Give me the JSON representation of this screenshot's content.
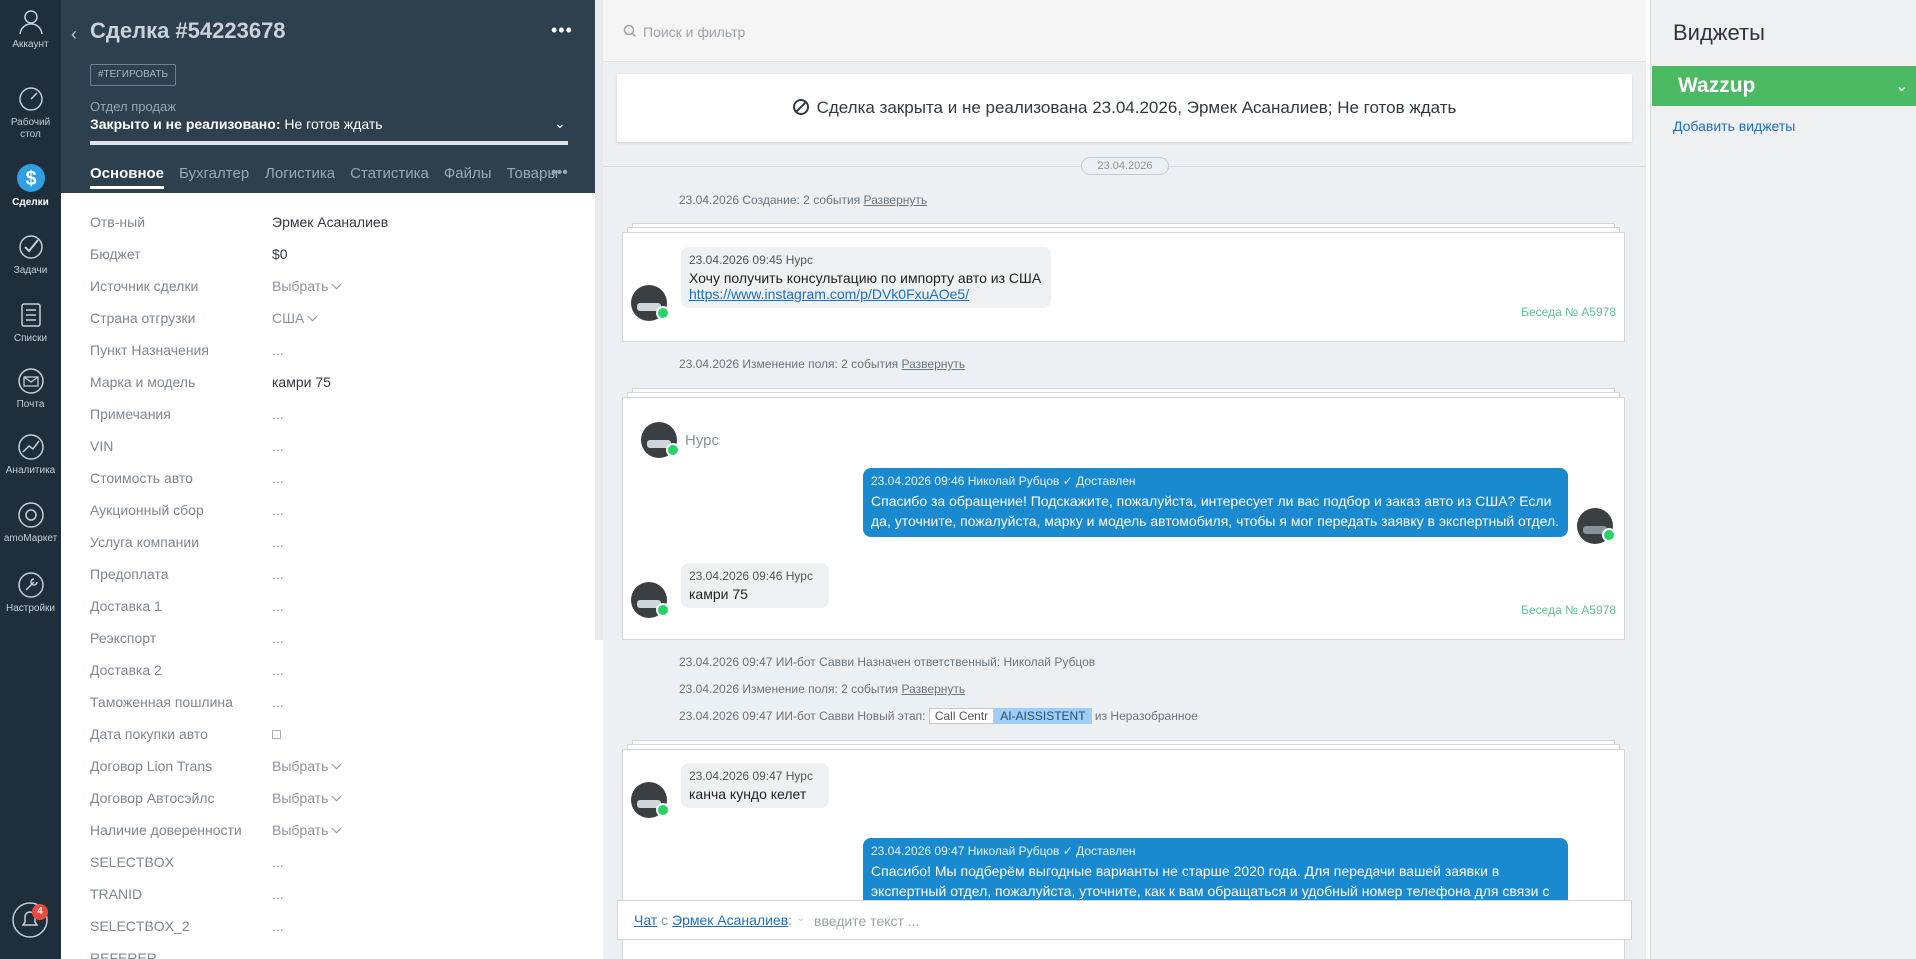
{
  "nav": {
    "account": "Аккаунт",
    "desktop": "Рабочий стол",
    "deals": "Сделки",
    "tasks": "Задачи",
    "lists": "Списки",
    "mail": "Почта",
    "analytics": "Аналитика",
    "market": "amoМаркет",
    "settings": "Настройки",
    "notifications_count": "4"
  },
  "card": {
    "title": "Сделка #54223678",
    "tag_button": "#ТЕГИРОВАТЬ",
    "pipeline": "Отдел продаж",
    "status_bold": "Закрыто и не реализовано:",
    "status_reason": " Не готов ждать",
    "tabs": [
      "Основное",
      "Бухгалтерия",
      "Логистика",
      "Статистика",
      "Файлы",
      "Товары"
    ],
    "fields": [
      {
        "label": "Отв-ный",
        "value": "Эрмек Асаналиев",
        "kind": "text"
      },
      {
        "label": "Бюджет",
        "value": "$0",
        "kind": "budget"
      },
      {
        "label": "Источник сделки",
        "value": "Выбрать",
        "kind": "select"
      },
      {
        "label": "Страна отгрузки",
        "value": "США",
        "kind": "select"
      },
      {
        "label": "Пункт Назначения",
        "value": "...",
        "kind": "dots"
      },
      {
        "label": "Марка и модель",
        "value": "камри 75",
        "kind": "text"
      },
      {
        "label": "Примечания",
        "value": "...",
        "kind": "dots"
      },
      {
        "label": "VIN",
        "value": "...",
        "kind": "dots"
      },
      {
        "label": "Стоимость авто",
        "value": "...",
        "kind": "dots"
      },
      {
        "label": "Аукционный сбор",
        "value": "...",
        "kind": "dots"
      },
      {
        "label": "Услуга компании",
        "value": "...",
        "kind": "dots"
      },
      {
        "label": "Предоплата",
        "value": "...",
        "kind": "dots"
      },
      {
        "label": "Доставка 1",
        "value": "...",
        "kind": "dots"
      },
      {
        "label": "Реэкспорт",
        "value": "...",
        "kind": "dots"
      },
      {
        "label": "Доставка 2",
        "value": "...",
        "kind": "dots"
      },
      {
        "label": "Таможенная пошлина",
        "value": "...",
        "kind": "dots"
      },
      {
        "label": "Дата покупки авто",
        "value": "",
        "kind": "date"
      },
      {
        "label": "Договор Lion Trans",
        "value": "Выбрать",
        "kind": "select"
      },
      {
        "label": "Договор Автосэйлс",
        "value": "Выбрать",
        "kind": "select"
      },
      {
        "label": "Наличие доверенности",
        "value": "Выбрать",
        "kind": "select"
      },
      {
        "label": "SELECTBOX",
        "value": "...",
        "kind": "dots"
      },
      {
        "label": "TRANID",
        "value": "...",
        "kind": "dots"
      },
      {
        "label": "SELECTBOX_2",
        "value": "...",
        "kind": "dots"
      },
      {
        "label": "REFERER",
        "value": "",
        "kind": "dots"
      }
    ]
  },
  "feed": {
    "search_placeholder": "Поиск и фильтр",
    "closed_banner": "Сделка закрыта и не реализована 23.04.2026, Эрмек Асаналиев; Не готов ждать",
    "date_pill": "23.04.2026",
    "sys1_text": "23.04.2026 Создание: 2 события ",
    "sys1_link": "Развернуть",
    "conv1": {
      "msg_meta": "23.04.2026 09:45 Нурс",
      "msg_text": "Хочу получить консультацию по импорту авто из США",
      "msg_link": "https://www.instagram.com/p/DVk0FxuAOe5/",
      "conv_id": "Беседа № A5978"
    },
    "sys2_text": "23.04.2026 Изменение поля: 2 события ",
    "sys2_link": "Развернуть",
    "conv2": {
      "name": "Нурс",
      "out_meta": "23.04.2026 09:46 Николай Рубцов",
      "out_status": "✓ Доставлен",
      "out_text": "Спасибо за обращение! Подскажите, пожалуйста, интересует ли вас подбор и заказ авто из США? Если да, уточните, пожалуйста, марку и модель автомобиля, чтобы я мог передать заявку в экспертный отдел.",
      "in_meta": "23.04.2026 09:46 Нурс",
      "in_text": "камри 75",
      "conv_id": "Беседа № A5978"
    },
    "sys3_text": "23.04.2026 09:47 ИИ-бот Савви Назначен ответственный: Николай Рубцов",
    "sys4_text": "23.04.2026 Изменение поля: 2 события ",
    "sys4_link": "Развернуть",
    "sys5_text": "23.04.2026 09:47 ИИ-бот Савви Новый этап: ",
    "sys5_stage_from": "Call Centr",
    "sys5_stage_to": "AI-AISSISTENT",
    "sys5_tail": " из Неразобранное",
    "conv3": {
      "in_meta": "23.04.2026 09:47 Нурс",
      "in_text": "канча кундо келет",
      "out_meta": "23.04.2026 09:47 Николай Рубцов",
      "out_status": "✓ Доставлен",
      "out_text": "Спасибо! Мы подберём выгодные варианты не старше 2020 года. Для передачи вашей заявки в экспертный отдел, пожалуйста, уточните, как к вам обращаться и удобный номер телефона для связи с"
    },
    "chat": {
      "chat_label": "Чат",
      "with": " с ",
      "contact": "Эрмек Асаналиев",
      "colon": ":",
      "placeholder": "введите текст ..."
    }
  },
  "widgets": {
    "title": "Виджеты",
    "wazzup": "Wazzup",
    "add": "Добавить виджеты"
  }
}
